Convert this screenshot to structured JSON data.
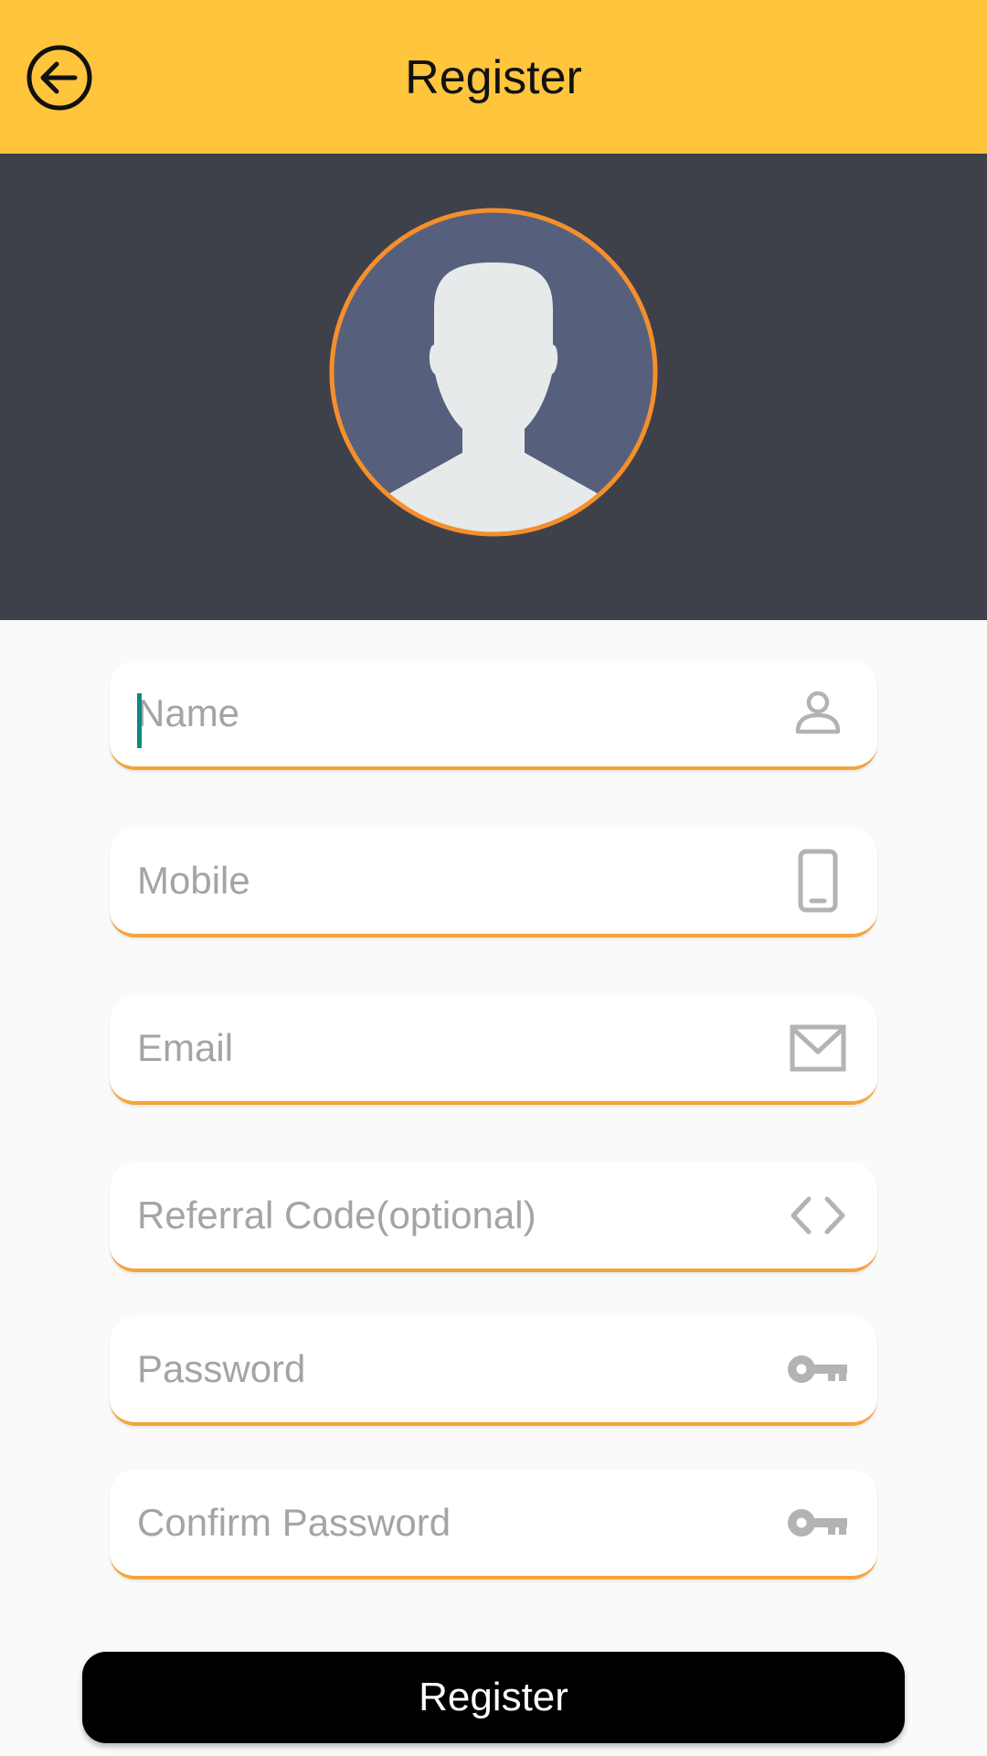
{
  "app_bar": {
    "title": "Register",
    "back_icon": "arrow-left-circle-icon",
    "background_color": "#ffc53d"
  },
  "profile": {
    "avatar_icon": "user-silhouette-icon",
    "ring_color": "#f58f2c",
    "band_color": "#3e414a"
  },
  "form": {
    "fields": [
      {
        "placeholder": "Name",
        "value": "",
        "icon": "person-icon"
      },
      {
        "placeholder": "Mobile",
        "value": "",
        "icon": "phone-icon"
      },
      {
        "placeholder": "Email",
        "value": "",
        "icon": "envelope-icon"
      },
      {
        "placeholder": "Referral Code(optional)",
        "value": "",
        "icon": "code-icon"
      },
      {
        "placeholder": "Password",
        "value": "",
        "icon": "key-icon"
      },
      {
        "placeholder": "Confirm Password",
        "value": "",
        "icon": "key-icon"
      }
    ],
    "accent_color": "#f4a53a",
    "submit_label": "Register"
  }
}
